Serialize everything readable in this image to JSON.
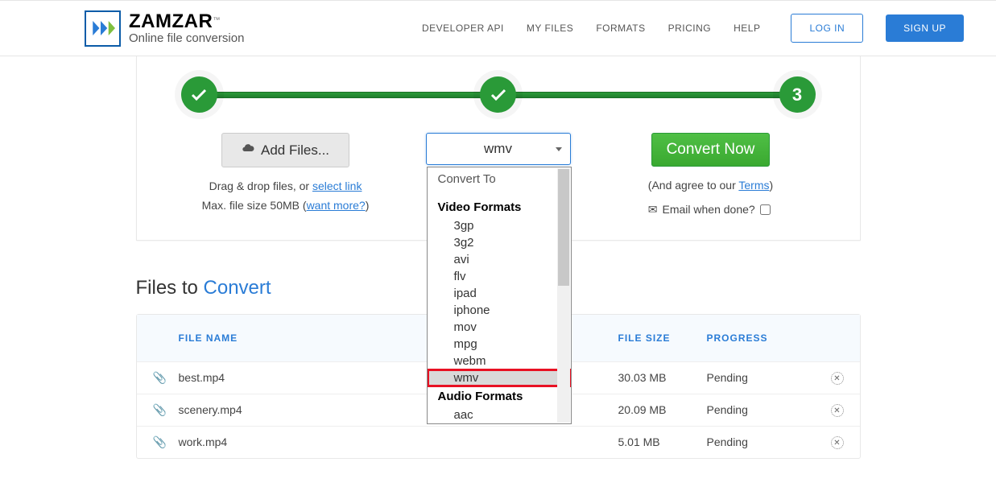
{
  "header": {
    "brand": "ZAMZAR",
    "tagline": "Online file conversion",
    "nav": [
      "DEVELOPER API",
      "MY FILES",
      "FORMATS",
      "PRICING",
      "HELP"
    ],
    "login": "LOG IN",
    "signup": "SIGN UP"
  },
  "steps": {
    "third": "3"
  },
  "upload": {
    "add_btn": "Add Files...",
    "hint1_pre": "Drag & drop files, or ",
    "hint1_link": "select link",
    "hint2_pre": "Max. file size 50MB (",
    "hint2_link": "want more?",
    "hint2_post": ")"
  },
  "format": {
    "selected": "wmv",
    "dropdown_header": "Convert To",
    "group_video": "Video Formats",
    "items_video": [
      "3gp",
      "3g2",
      "avi",
      "flv",
      "ipad",
      "iphone",
      "mov",
      "mpg",
      "webm",
      "wmv"
    ],
    "group_audio": "Audio Formats",
    "items_audio": [
      "aac"
    ]
  },
  "convert": {
    "btn": "Convert Now",
    "agree_pre": "(And agree to our ",
    "agree_link": "Terms",
    "agree_post": ")",
    "email_label": "Email when done?"
  },
  "list": {
    "title_a": "Files to ",
    "title_b": "Convert",
    "headers": {
      "name": "FILE NAME",
      "size": "FILE SIZE",
      "progress": "PROGRESS"
    },
    "rows": [
      {
        "name": "best.mp4",
        "size": "30.03 MB",
        "progress": "Pending"
      },
      {
        "name": "scenery.mp4",
        "size": "20.09 MB",
        "progress": "Pending"
      },
      {
        "name": "work.mp4",
        "size": "5.01 MB",
        "progress": "Pending"
      }
    ]
  }
}
